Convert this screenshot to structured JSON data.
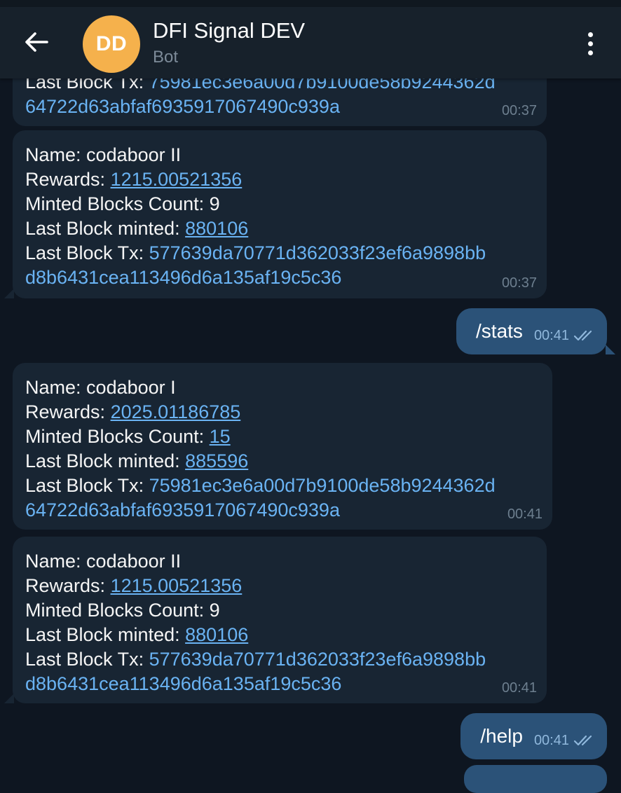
{
  "header": {
    "title": "DFI Signal DEV",
    "subtitle": "Bot",
    "avatar_initials": "DD",
    "avatar_color": "#f5b14c"
  },
  "labels": {
    "name": "Name:",
    "rewards": "Rewards:",
    "minted": "Minted Blocks Count:",
    "last_minted": "Last Block minted:",
    "last_tx": "Last Block Tx:"
  },
  "messages": [
    {
      "type": "in",
      "partial_line": "Last Block Tx: 75981ec3e6a00d7b9100de58b9244362d",
      "hash_line2": "64722d63abfaf6935917067490c939a",
      "time": "00:37"
    },
    {
      "type": "in",
      "name": "codaboor II",
      "rewards": "1215.00521356",
      "minted_count": "9",
      "last_minted": "880106",
      "hash_line1": "577639da70771d362033f23ef6a9898bb",
      "hash_line2": "d8b6431cea113496d6a135af19c5c36",
      "time": "00:37"
    },
    {
      "type": "out",
      "text": "/stats",
      "time": "00:41"
    },
    {
      "type": "in",
      "name": "codaboor I",
      "rewards": "2025.01186785",
      "minted_count": "15",
      "last_minted": "885596",
      "hash_line1": "75981ec3e6a00d7b9100de58b9244362d",
      "hash_line2": "64722d63abfaf6935917067490c939a",
      "time": "00:41"
    },
    {
      "type": "in",
      "name": "codaboor II",
      "rewards": "1215.00521356",
      "minted_count": "9",
      "last_minted": "880106",
      "hash_line1": "577639da70771d362033f23ef6a9898bb",
      "hash_line2": "d8b6431cea113496d6a135af19c5c36",
      "time": "00:41"
    },
    {
      "type": "out",
      "text": "/help",
      "time": "00:41"
    }
  ],
  "icons": {
    "back": "arrow-left-icon",
    "menu": "more-vertical-icon",
    "read": "double-check-icon"
  },
  "colors": {
    "background": "#0e1621",
    "header": "#17212b",
    "incoming_bubble": "#182533",
    "outgoing_bubble": "#2b5278",
    "link": "#6ab3f3"
  }
}
